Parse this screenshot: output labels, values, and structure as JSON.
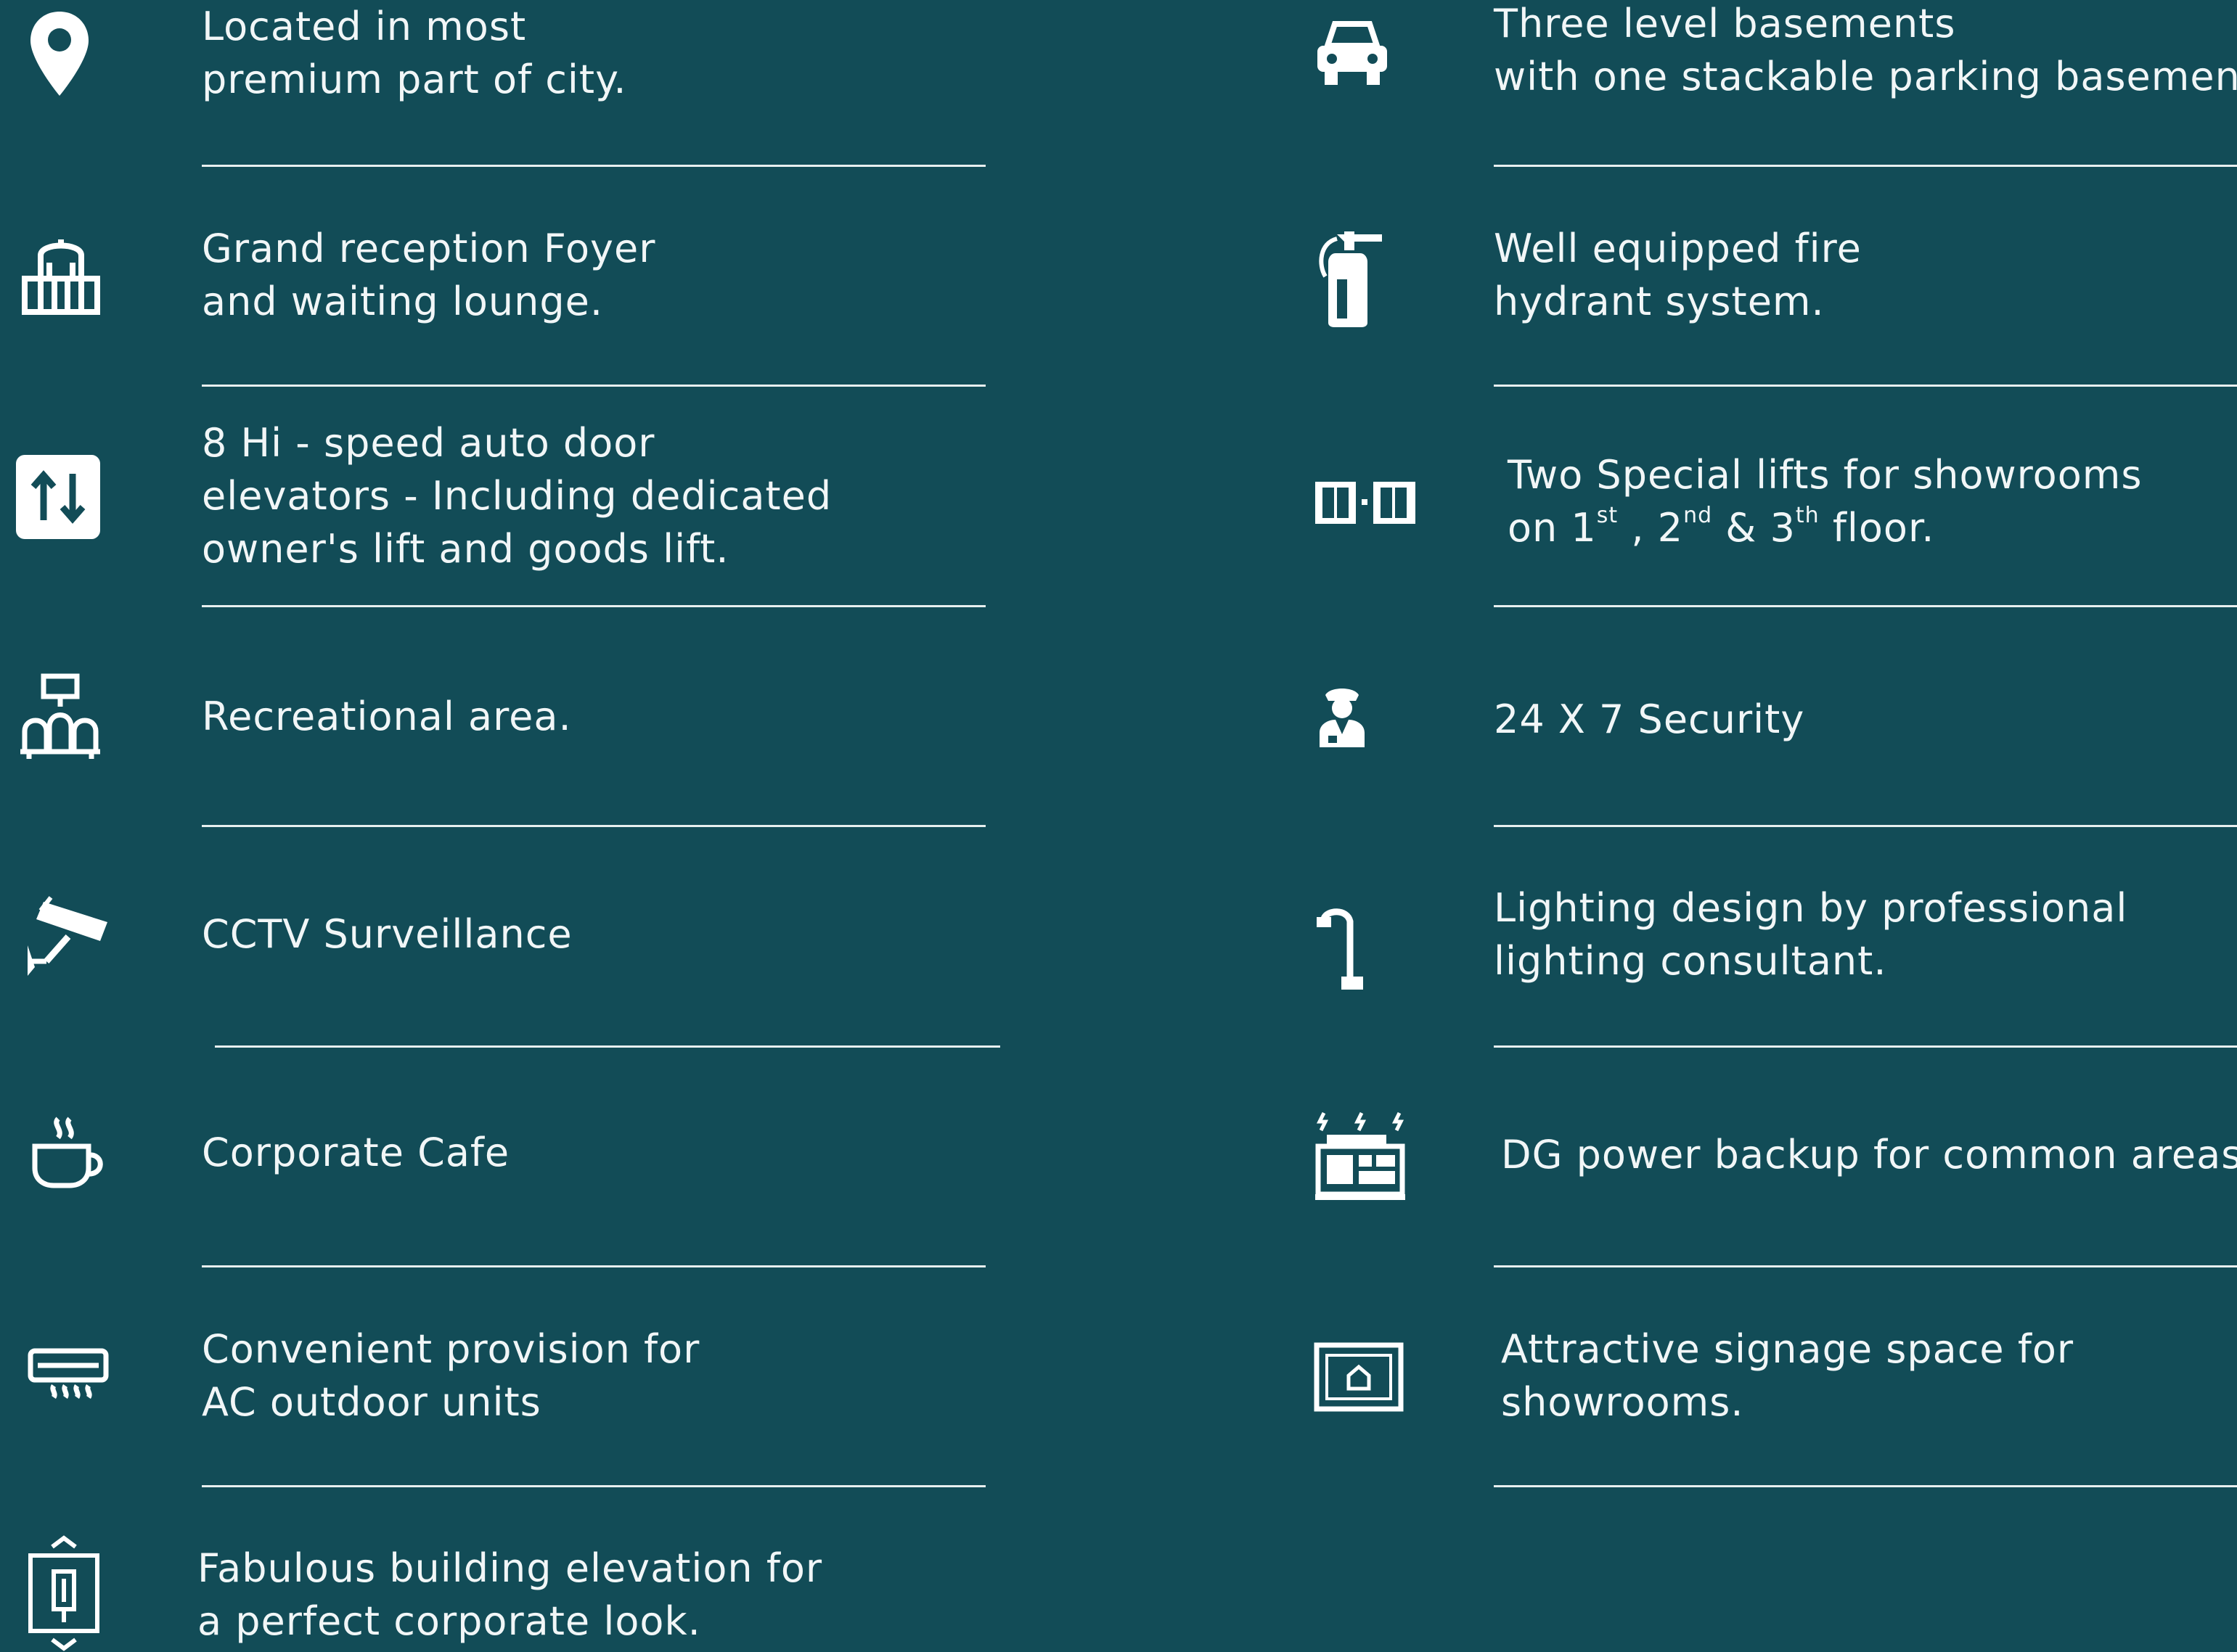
{
  "left_column": [
    {
      "icon": "location-pin-icon",
      "lines": [
        "Located in most",
        "premium part of city."
      ]
    },
    {
      "icon": "reception-foyer-icon",
      "lines": [
        "Grand reception Foyer",
        "and waiting lounge."
      ]
    },
    {
      "icon": "elevator-icon",
      "lines": [
        "8 Hi - speed auto door",
        "elevators - Including dedicated",
        "owner's lift and goods lift."
      ]
    },
    {
      "icon": "recreation-icon",
      "lines": [
        "Recreational area."
      ]
    },
    {
      "icon": "cctv-camera-icon",
      "lines": [
        "CCTV Surveillance"
      ]
    },
    {
      "icon": "coffee-cup-icon",
      "lines": [
        "Corporate Cafe"
      ]
    },
    {
      "icon": "air-conditioner-icon",
      "lines": [
        "Convenient provision for",
        "AC outdoor units"
      ]
    },
    {
      "icon": "building-elevation-icon",
      "lines": [
        "Fabulous building elevation for",
        "a perfect corporate look."
      ]
    }
  ],
  "right_column": [
    {
      "icon": "car-icon",
      "lines": [
        "Three level basements",
        "with one stackable parking basement."
      ]
    },
    {
      "icon": "fire-extinguisher-icon",
      "lines": [
        "Well equipped fire",
        "hydrant system."
      ]
    },
    {
      "icon": "lift-doors-icon",
      "line1": "Two Special lifts for showrooms",
      "line2": {
        "on": "on 1",
        "st": "st",
        "sep1": " , 2",
        "nd": "nd",
        "sep2": " & 3",
        "th": "th",
        "floor": " floor."
      }
    },
    {
      "icon": "security-guard-icon",
      "lines": [
        "24 X 7 Security"
      ]
    },
    {
      "icon": "street-lamp-icon",
      "lines": [
        "Lighting design by professional",
        "lighting consultant."
      ]
    },
    {
      "icon": "generator-icon",
      "lines": [
        "DG power backup for common areas."
      ]
    },
    {
      "icon": "signage-board-icon",
      "lines": [
        "Attractive signage space for",
        "showrooms."
      ]
    }
  ],
  "colors": {
    "background": "#124c57",
    "text": "#f1f6f7",
    "divider": "#e7efef"
  }
}
